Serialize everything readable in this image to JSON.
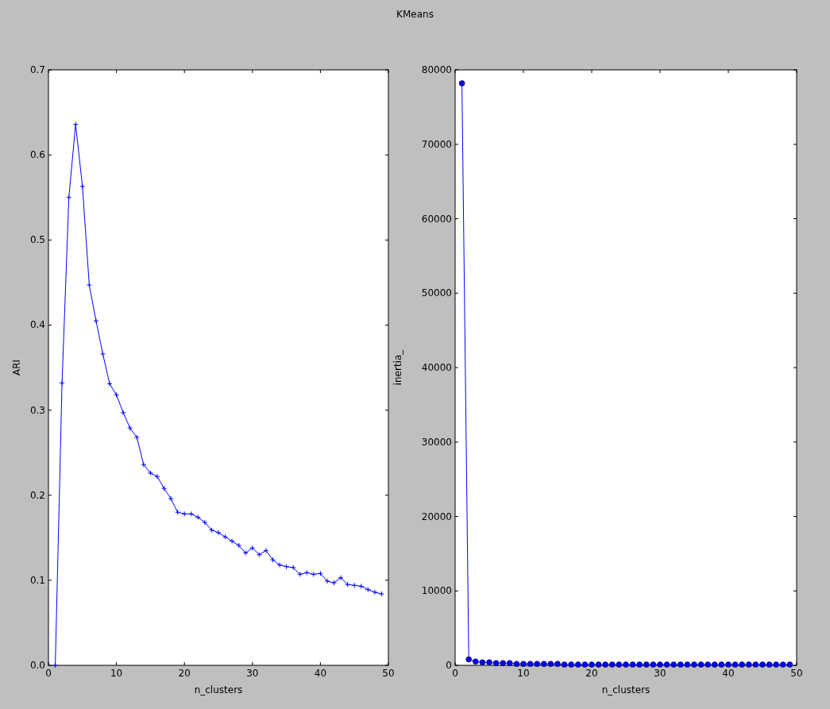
{
  "figure": {
    "title": "KMeans"
  },
  "panels": [
    {
      "chart_data": {
        "type": "line",
        "xlabel": "n_clusters",
        "ylabel": "ARI",
        "xlim": [
          0,
          50
        ],
        "ylim": [
          0,
          0.7
        ],
        "xticks": [
          0,
          10,
          20,
          30,
          40,
          50
        ],
        "yticks": [
          {
            "value": 0,
            "label": "0.0"
          },
          {
            "value": 0.1,
            "label": "0.1"
          },
          {
            "value": 0.2,
            "label": "0.2"
          },
          {
            "value": 0.3,
            "label": "0.3"
          },
          {
            "value": 0.4,
            "label": "0.4"
          },
          {
            "value": 0.5,
            "label": "0.5"
          },
          {
            "value": 0.6,
            "label": "0.6"
          },
          {
            "value": 0.7,
            "label": "0.7"
          }
        ],
        "x": [
          1,
          2,
          3,
          4,
          5,
          6,
          7,
          8,
          9,
          10,
          11,
          12,
          13,
          14,
          15,
          16,
          17,
          18,
          19,
          20,
          21,
          22,
          23,
          24,
          25,
          26,
          27,
          28,
          29,
          30,
          31,
          32,
          33,
          34,
          35,
          36,
          37,
          38,
          39,
          40,
          41,
          42,
          43,
          44,
          45,
          46,
          47,
          48,
          49
        ],
        "series": [
          {
            "color": "#0000ff",
            "marker": "+",
            "values": [
              0.0,
              0.332,
              0.55,
              0.636,
              0.563,
              0.447,
              0.405,
              0.366,
              0.331,
              0.318,
              0.297,
              0.279,
              0.268,
              0.236,
              0.226,
              0.222,
              0.208,
              0.196,
              0.18,
              0.178,
              0.178,
              0.174,
              0.168,
              0.159,
              0.156,
              0.151,
              0.146,
              0.141,
              0.132,
              0.138,
              0.13,
              0.135,
              0.124,
              0.118,
              0.116,
              0.115,
              0.107,
              0.109,
              0.107,
              0.108,
              0.099,
              0.097,
              0.103,
              0.095,
              0.094,
              0.093,
              0.089,
              0.086,
              0.084
            ]
          }
        ]
      }
    },
    {
      "chart_data": {
        "type": "line",
        "xlabel": "n_clusters",
        "ylabel": "inertia_",
        "xlim": [
          0,
          50
        ],
        "ylim": [
          0,
          80000
        ],
        "xticks": [
          0,
          10,
          20,
          30,
          40,
          50
        ],
        "yticks": [
          0,
          10000,
          20000,
          30000,
          40000,
          50000,
          60000,
          70000,
          80000
        ],
        "x": [
          1,
          2,
          3,
          4,
          5,
          6,
          7,
          8,
          9,
          10,
          11,
          12,
          13,
          14,
          15,
          16,
          17,
          18,
          19,
          20,
          21,
          22,
          23,
          24,
          25,
          26,
          27,
          28,
          29,
          30,
          31,
          32,
          33,
          34,
          35,
          36,
          37,
          38,
          39,
          40,
          41,
          42,
          43,
          44,
          45,
          46,
          47,
          48,
          49
        ],
        "series": [
          {
            "color": "#0000ff",
            "marker": "o",
            "values": [
              78200,
              800,
              500,
              400,
              400,
              300,
              300,
              300,
              200,
              200,
              200,
              200,
              200,
              200,
              200,
              100,
              100,
              100,
              100,
              100,
              100,
              100,
              100,
              100,
              100,
              100,
              100,
              100,
              100,
              100,
              100,
              100,
              100,
              100,
              100,
              100,
              100,
              100,
              100,
              100,
              100,
              100,
              100,
              100,
              100,
              100,
              100,
              100,
              100
            ]
          }
        ]
      }
    }
  ]
}
